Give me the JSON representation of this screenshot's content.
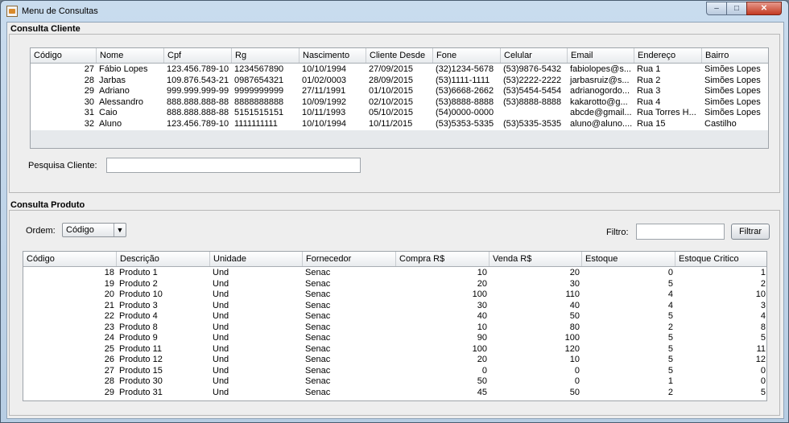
{
  "window": {
    "title": "Menu de Consultas",
    "controls": {
      "minimize": "–",
      "maximize": "□",
      "close": "✕"
    }
  },
  "clientes": {
    "section_title": "Consulta Cliente",
    "columns": [
      "Código",
      "Nome",
      "Cpf",
      "Rg",
      "Nascimento",
      "Cliente Desde",
      "Fone",
      "Celular",
      "Email",
      "Endereço",
      "Bairro"
    ],
    "rows": [
      [
        "27",
        "Fábio Lopes",
        "123.456.789-10",
        "1234567890",
        "10/10/1994",
        "27/09/2015",
        "(32)1234-5678",
        "(53)9876-5432",
        "fabiolopes@s...",
        "Rua 1",
        "Simões Lopes"
      ],
      [
        "28",
        "Jarbas",
        "109.876.543-21",
        "0987654321",
        "01/02/0003",
        "28/09/2015",
        "(53)1111-1111",
        "(53)2222-2222",
        "jarbasruiz@s...",
        "Rua 2",
        "Simões Lopes"
      ],
      [
        "29",
        "Adriano",
        "999.999.999-99",
        "9999999999",
        "27/11/1991",
        "01/10/2015",
        "(53)6668-2662",
        "(53)5454-5454",
        "adrianogordo...",
        "Rua 3",
        "Simões Lopes"
      ],
      [
        "30",
        "Alessandro",
        "888.888.888-88",
        "8888888888",
        "10/09/1992",
        "02/10/2015",
        "(53)8888-8888",
        "(53)8888-8888",
        "kakarotto@g...",
        "Rua 4",
        "Simões Lopes"
      ],
      [
        "31",
        "Caio",
        "888.888.888-88",
        "5151515151",
        "10/11/1993",
        "05/10/2015",
        "(54)0000-0000",
        "",
        "abcde@gmail...",
        "Rua Torres H...",
        "Simões Lopes"
      ],
      [
        "32",
        "Aluno",
        "123.456.789-10",
        "1111111111",
        "10/10/1994",
        "10/11/2015",
        "(53)5353-5335",
        "(53)5335-3535",
        "aluno@aluno....",
        "Rua 15",
        "Castilho"
      ]
    ],
    "search_label": "Pesquisa Cliente:",
    "search_value": ""
  },
  "produtos": {
    "section_title": "Consulta Produto",
    "order_label": "Ordem:",
    "order_selected": "Código",
    "filter_label": "Filtro:",
    "filter_value": "",
    "filter_button": "Filtrar",
    "columns": [
      "Código",
      "Descrição",
      "Unidade",
      "Fornecedor",
      "Compra R$",
      "Venda R$",
      "Estoque",
      "Estoque Critico"
    ],
    "rows": [
      [
        "18",
        "Produto 1",
        "Und",
        "Senac",
        "10",
        "20",
        "0",
        "1"
      ],
      [
        "19",
        "Produto 2",
        "Und",
        "Senac",
        "20",
        "30",
        "5",
        "2"
      ],
      [
        "20",
        "Produto 10",
        "Und",
        "Senac",
        "100",
        "110",
        "4",
        "10"
      ],
      [
        "21",
        "Produto 3",
        "Und",
        "Senac",
        "30",
        "40",
        "4",
        "3"
      ],
      [
        "22",
        "Produto 4",
        "Und",
        "Senac",
        "40",
        "50",
        "5",
        "4"
      ],
      [
        "23",
        "Produto 8",
        "Und",
        "Senac",
        "10",
        "80",
        "2",
        "8"
      ],
      [
        "24",
        "Produto 9",
        "Und",
        "Senac",
        "90",
        "100",
        "5",
        "5"
      ],
      [
        "25",
        "Produto 11",
        "Und",
        "Senac",
        "100",
        "120",
        "5",
        "11"
      ],
      [
        "26",
        "Produto 12",
        "Und",
        "Senac",
        "20",
        "10",
        "5",
        "12"
      ],
      [
        "27",
        "Produto 15",
        "Und",
        "Senac",
        "0",
        "0",
        "5",
        "0"
      ],
      [
        "28",
        "Produto 30",
        "Und",
        "Senac",
        "50",
        "0",
        "1",
        "0"
      ],
      [
        "29",
        "Produto 31",
        "Und",
        "Senac",
        "45",
        "50",
        "2",
        "5"
      ]
    ]
  }
}
